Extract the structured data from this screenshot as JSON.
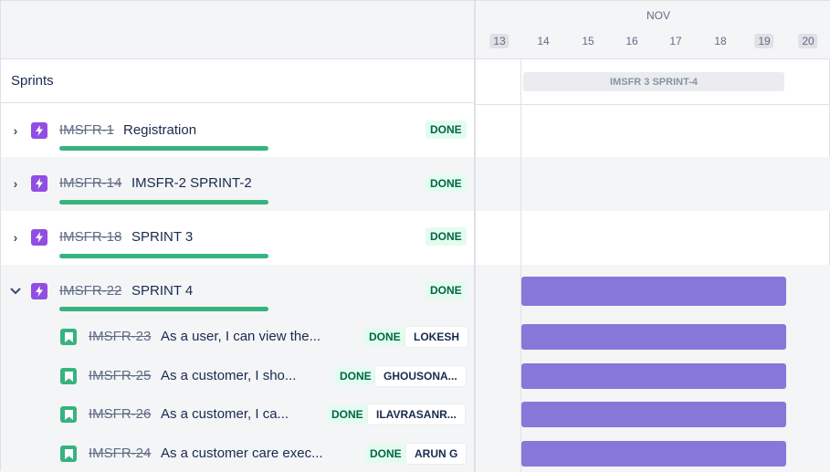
{
  "timeline": {
    "month": "NOV",
    "days": [
      {
        "label": "13",
        "highlighted": true
      },
      {
        "label": "14",
        "highlighted": false
      },
      {
        "label": "15",
        "highlighted": false
      },
      {
        "label": "16",
        "highlighted": false
      },
      {
        "label": "17",
        "highlighted": false
      },
      {
        "label": "18",
        "highlighted": false
      },
      {
        "label": "19",
        "highlighted": true
      },
      {
        "label": "20",
        "highlighted": true
      }
    ],
    "sprint_label": "IMSFR 3 SPRINT-4"
  },
  "sidebar": {
    "title": "Sprints"
  },
  "epics": [
    {
      "key": "IMSFR-1",
      "summary": "Registration",
      "status": "DONE",
      "expanded": false
    },
    {
      "key": "IMSFR-14",
      "summary": "IMSFR-2 SPRINT-2",
      "status": "DONE",
      "expanded": false
    },
    {
      "key": "IMSFR-18",
      "summary": "SPRINT 3",
      "status": "DONE",
      "expanded": false
    },
    {
      "key": "IMSFR-22",
      "summary": "SPRINT 4",
      "status": "DONE",
      "expanded": true
    }
  ],
  "stories": [
    {
      "key": "IMSFR-23",
      "summary": "As a user, I can view the...",
      "status": "DONE",
      "assignee": "LOKESH"
    },
    {
      "key": "IMSFR-25",
      "summary": "As a customer, I sho...",
      "status": "DONE",
      "assignee": "GHOUSONA..."
    },
    {
      "key": "IMSFR-26",
      "summary": "As a customer, I ca...",
      "status": "DONE",
      "assignee": "ILAVRASANR..."
    },
    {
      "key": "IMSFR-24",
      "summary": "As a customer care exec...",
      "status": "DONE",
      "assignee": "ARUN G"
    }
  ],
  "colors": {
    "epic_icon": "#904ee2",
    "story_icon": "#36b37e",
    "bar": "#8777d9",
    "done_bg": "#e3fcef",
    "done_text": "#006644",
    "progress": "#36b37e"
  },
  "icons": {
    "epic": "lightning-icon",
    "story": "bookmark-icon",
    "collapsed": "chevron-right-icon",
    "expanded": "chevron-down-icon"
  }
}
